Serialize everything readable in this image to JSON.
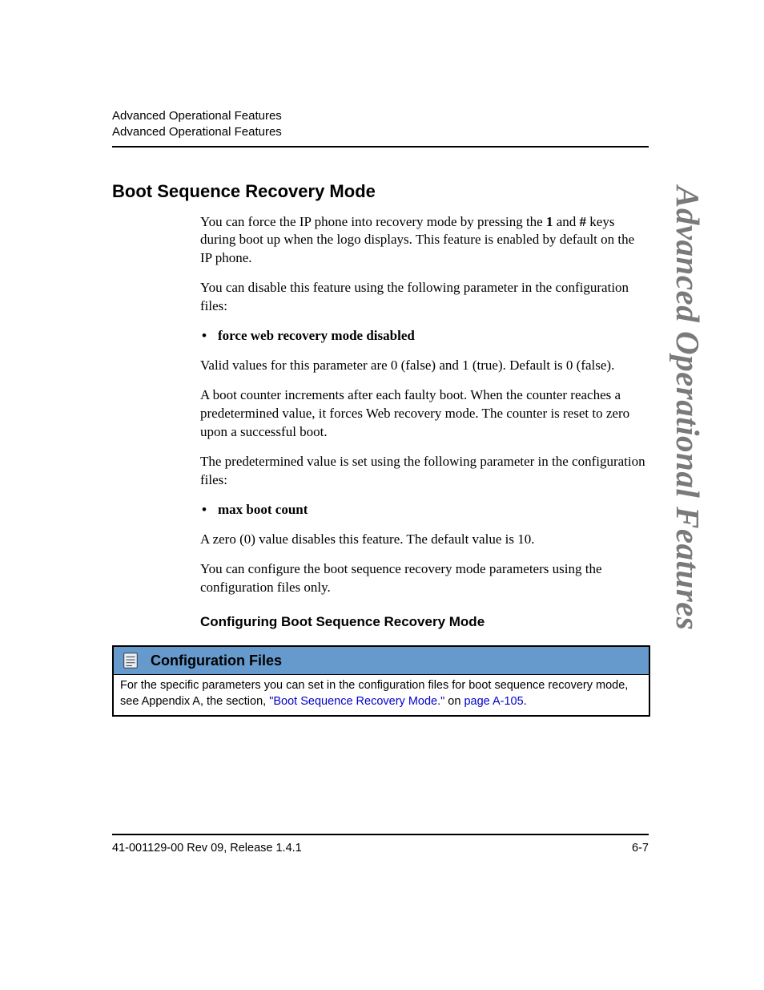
{
  "header": {
    "line1": "Advanced Operational Features",
    "line2": "Advanced Operational Features"
  },
  "side_label": "Advanced Operational Features",
  "section": {
    "title": "Boot Sequence Recovery Mode",
    "p1_pre": "You can force the IP phone into recovery mode by pressing the ",
    "p1_key1": "1",
    "p1_mid": " and ",
    "p1_key2": "#",
    "p1_post": " keys during boot up when the logo displays. This feature is enabled by default on the IP phone.",
    "p2": "You can disable this feature using the following parameter in the configuration files:",
    "bullet1": "force web recovery mode disabled",
    "p3": "Valid values for this parameter are 0 (false) and 1 (true). Default is 0 (false).",
    "p4": "A boot counter increments after each faulty boot. When the counter reaches a predetermined value, it forces Web recovery mode. The counter is reset to zero upon a successful boot.",
    "p5": "The predetermined value is set using the following parameter in the configuration files:",
    "bullet2": "max boot count",
    "p6": "A zero (0) value disables this feature.  The default value is 10.",
    "p7": "You can configure the boot sequence recovery mode parameters using the configuration files only.",
    "subheading": "Configuring Boot Sequence Recovery Mode"
  },
  "config_box": {
    "title": "Configuration Files",
    "body_pre": "For the specific parameters you can set in the configuration files for boot sequence recovery mode, see Appendix A, the section, ",
    "link1": "\"Boot Sequence Recovery Mode.\"",
    "body_mid": " on ",
    "link2": "page A-105",
    "body_post": "."
  },
  "footer": {
    "left": "41-001129-00 Rev 09, Release 1.4.1",
    "right": "6-7"
  }
}
